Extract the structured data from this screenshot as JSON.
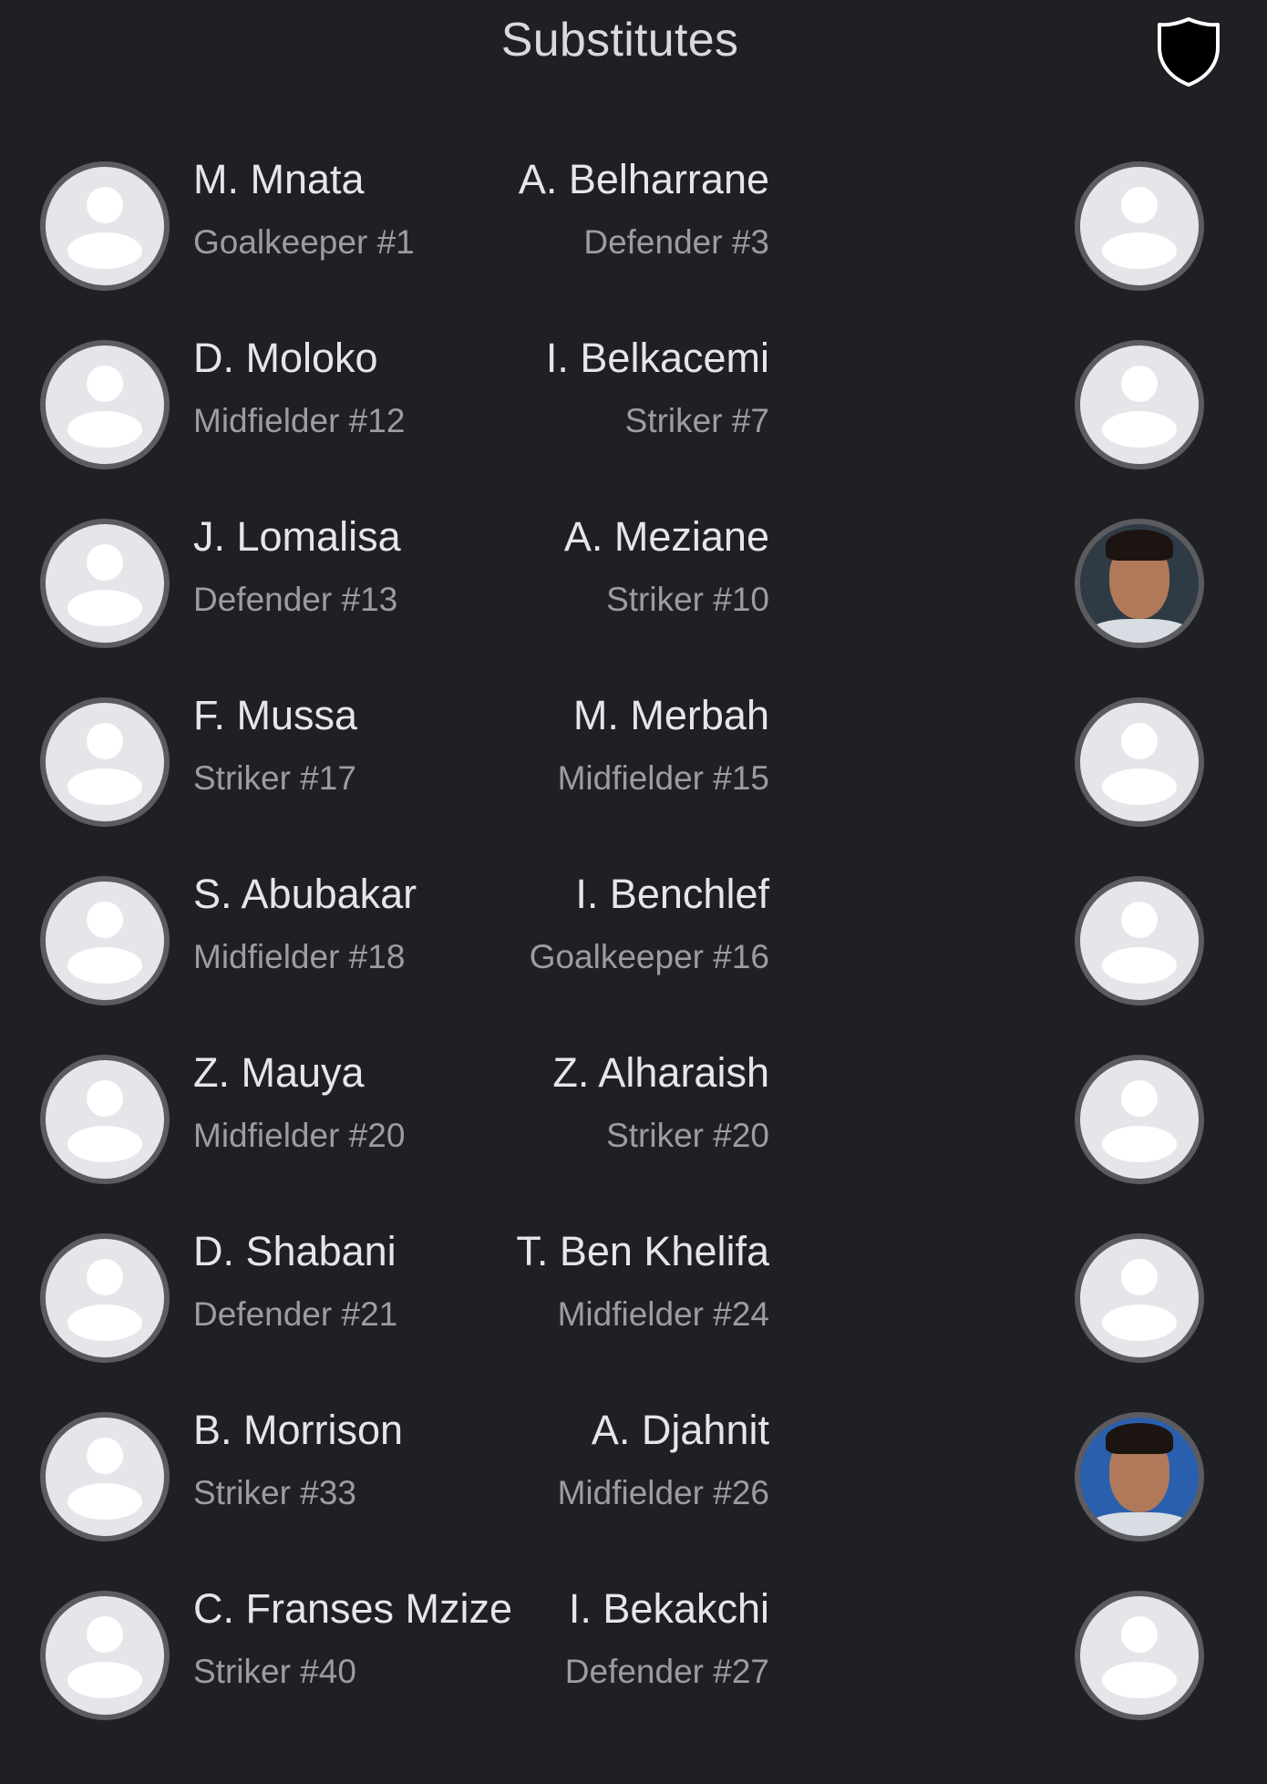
{
  "header": {
    "title": "Substitutes",
    "icon": "shield-icon"
  },
  "colors": {
    "background": "#1f2024",
    "avatar_fill": "#e5e5ea",
    "avatar_ring": "#5b5b60",
    "name_text": "#e6e6e9",
    "role_text": "#9c9ca2"
  },
  "rows": [
    {
      "left": {
        "name": "M. Mnata",
        "role": "Goalkeeper #1",
        "avatar": "default-avatar-icon"
      },
      "right": {
        "name": "A. Belharrane",
        "role": "Defender #3",
        "avatar": "default-avatar-icon"
      }
    },
    {
      "left": {
        "name": "D. Moloko",
        "role": "Midfielder #12",
        "avatar": "default-avatar-icon"
      },
      "right": {
        "name": "I. Belkacemi",
        "role": "Striker #7",
        "avatar": "default-avatar-icon"
      }
    },
    {
      "left": {
        "name": "J. Lomalisa",
        "role": "Defender #13",
        "avatar": "default-avatar-icon"
      },
      "right": {
        "name": "A. Meziane",
        "role": "Striker #10",
        "avatar": "player-photo"
      }
    },
    {
      "left": {
        "name": "F. Mussa",
        "role": "Striker #17",
        "avatar": "default-avatar-icon"
      },
      "right": {
        "name": "M. Merbah",
        "role": "Midfielder #15",
        "avatar": "default-avatar-icon"
      }
    },
    {
      "left": {
        "name": "S. Abubakar",
        "role": "Midfielder #18",
        "avatar": "default-avatar-icon"
      },
      "right": {
        "name": "I. Benchlef",
        "role": "Goalkeeper #16",
        "avatar": "default-avatar-icon"
      }
    },
    {
      "left": {
        "name": "Z. Mauya",
        "role": "Midfielder #20",
        "avatar": "default-avatar-icon"
      },
      "right": {
        "name": "Z. Alharaish",
        "role": "Striker #20",
        "avatar": "default-avatar-icon"
      }
    },
    {
      "left": {
        "name": "D. Shabani",
        "role": "Defender #21",
        "avatar": "default-avatar-icon"
      },
      "right": {
        "name": "T. Ben Khelifa",
        "role": "Midfielder #24",
        "avatar": "default-avatar-icon"
      }
    },
    {
      "left": {
        "name": "B. Morrison",
        "role": "Striker #33",
        "avatar": "default-avatar-icon"
      },
      "right": {
        "name": "A. Djahnit",
        "role": "Midfielder #26",
        "avatar": "player-photo"
      }
    },
    {
      "left": {
        "name": "C. Franses Mzize",
        "role": "Striker #40",
        "avatar": "default-avatar-icon"
      },
      "right": {
        "name": "I. Bekakchi",
        "role": "Defender #27",
        "avatar": "default-avatar-icon"
      }
    }
  ]
}
